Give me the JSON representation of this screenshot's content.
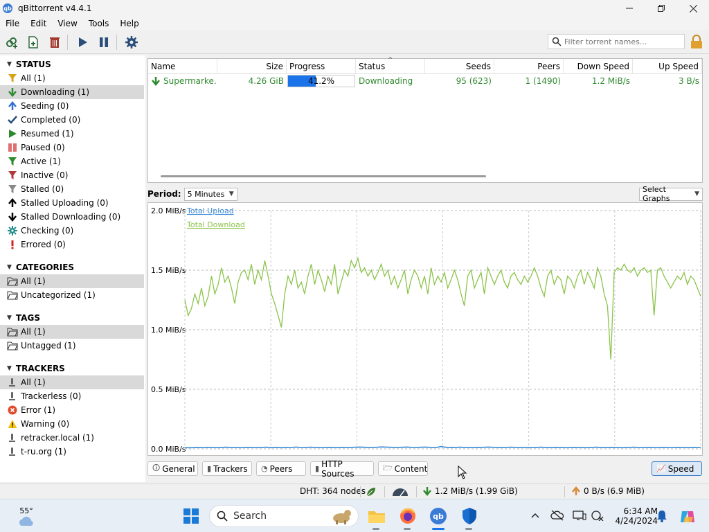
{
  "window": {
    "title": "qBittorrent v4.4.1",
    "app_icon": "qb"
  },
  "menu": [
    "File",
    "Edit",
    "View",
    "Tools",
    "Help"
  ],
  "toolbar": {
    "search_placeholder": "Filter torrent names..."
  },
  "sidebar": {
    "status": {
      "header": "STATUS",
      "items": [
        {
          "label": "All (1)",
          "icon": "filter-icon",
          "color": "#d8a21b"
        },
        {
          "label": "Downloading (1)",
          "icon": "arrow-down-icon",
          "color": "#2f8a2f"
        },
        {
          "label": "Seeding (0)",
          "icon": "arrow-up-icon",
          "color": "#2f6fd1"
        },
        {
          "label": "Completed (0)",
          "icon": "check-icon",
          "color": "#2a4d7a"
        },
        {
          "label": "Resumed (1)",
          "icon": "play-icon",
          "color": "#2f8a2f"
        },
        {
          "label": "Paused (0)",
          "icon": "pause-icon",
          "color": "#e07070"
        },
        {
          "label": "Active (1)",
          "icon": "filter-icon",
          "color": "#2f8a2f"
        },
        {
          "label": "Inactive (0)",
          "icon": "filter-icon",
          "color": "#b03a3a"
        },
        {
          "label": "Stalled (0)",
          "icon": "filter-icon",
          "color": "#888888"
        },
        {
          "label": "Stalled Uploading (0)",
          "icon": "arrow-up-icon",
          "color": "#000000"
        },
        {
          "label": "Stalled Downloading (0)",
          "icon": "arrow-down-icon",
          "color": "#000000"
        },
        {
          "label": "Checking (0)",
          "icon": "gear-icon",
          "color": "#1a8a8a"
        },
        {
          "label": "Errored (0)",
          "icon": "exclamation-icon",
          "color": "#d42020"
        }
      ]
    },
    "categories": {
      "header": "CATEGORIES",
      "items": [
        {
          "label": "All (1)",
          "icon": "folder-icon"
        },
        {
          "label": "Uncategorized (1)",
          "icon": "folder-icon"
        }
      ]
    },
    "tags": {
      "header": "TAGS",
      "items": [
        {
          "label": "All (1)",
          "icon": "folder-icon"
        },
        {
          "label": "Untagged (1)",
          "icon": "folder-icon"
        }
      ]
    },
    "trackers": {
      "header": "TRACKERS",
      "items": [
        {
          "label": "All (1)",
          "icon": "tracker-icon"
        },
        {
          "label": "Trackerless (0)",
          "icon": "tracker-icon"
        },
        {
          "label": "Error (1)",
          "icon": "error-icon"
        },
        {
          "label": "Warning (0)",
          "icon": "warning-icon"
        },
        {
          "label": "retracker.local (1)",
          "icon": "tracker-icon"
        },
        {
          "label": "t-ru.org (1)",
          "icon": "tracker-icon"
        }
      ]
    }
  },
  "torrents": {
    "columns": [
      "Name",
      "Size",
      "Progress",
      "Status",
      "Seeds",
      "Peers",
      "Down Speed",
      "Up Speed"
    ],
    "rows": [
      {
        "name": "Supermarke...",
        "size": "4.26 GiB",
        "progress_text": "41.2%",
        "progress": 0.412,
        "status": "Downloading",
        "seeds": "95 (623)",
        "peers": "1 (1490)",
        "down_speed": "1.2 MiB/s",
        "up_speed": "3 B/s"
      }
    ]
  },
  "period": {
    "label": "Period:",
    "value": "5 Minutes",
    "graphs_value": "Select Graphs"
  },
  "chart_data": {
    "type": "line",
    "title": "",
    "xlabel": "",
    "ylabel": "",
    "y_ticks": [
      "0.0 MiB/s",
      "0.5 MiB/s",
      "1.0 MiB/s",
      "1.5 MiB/s",
      "2.0 MiB/s"
    ],
    "ylim": [
      0,
      2.0
    ],
    "grid": true,
    "legend_position": "top-left",
    "series": [
      {
        "name": "Total Upload",
        "color": "#3a8ad6",
        "values": [
          0.01,
          0.01,
          0.01,
          0.012,
          0.011,
          0.01,
          0.013,
          0.012,
          0.011,
          0.01,
          0.012,
          0.014,
          0.013,
          0.012,
          0.011,
          0.01,
          0.012,
          0.013,
          0.012,
          0.011,
          0.012,
          0.013,
          0.014,
          0.012,
          0.011,
          0.012,
          0.01,
          0.011,
          0.012,
          0.013,
          0.015,
          0.012,
          0.011,
          0.013,
          0.014,
          0.012,
          0.011,
          0.01,
          0.012,
          0.013,
          0.012,
          0.011,
          0.013,
          0.012,
          0.011,
          0.012,
          0.014,
          0.015,
          0.014,
          0.013,
          0.012,
          0.013,
          0.014,
          0.016,
          0.015,
          0.014,
          0.013,
          0.012,
          0.013,
          0.014,
          0.015,
          0.013,
          0.012,
          0.013,
          0.014,
          0.015,
          0.012,
          0.011,
          0.013,
          0.02,
          0.015,
          0.012,
          0.013,
          0.012,
          0.014,
          0.013,
          0.012,
          0.011,
          0.012,
          0.013,
          0.012,
          0.014,
          0.015,
          0.013,
          0.012,
          0.011,
          0.012,
          0.013,
          0.014,
          0.012,
          0.011,
          0.012,
          0.013,
          0.012,
          0.011,
          0.013,
          0.014,
          0.012,
          0.011,
          0.012,
          0.013,
          0.012,
          0.011,
          0.01,
          0.012,
          0.013,
          0.012,
          0.011,
          0.01,
          0.012,
          0.013,
          0.014,
          0.012,
          0.011,
          0.012,
          0.013,
          0.012,
          0.011,
          0.01,
          0.012,
          0.013,
          0.014,
          0.012,
          0.011,
          0.012,
          0.013,
          0.012,
          0.011,
          0.012,
          0.013,
          0.012,
          0.011,
          0.012,
          0.013,
          0.012,
          0.011,
          0.012,
          0.013,
          0.012,
          0.011
        ]
      },
      {
        "name": "Total Download",
        "color": "#8bc34a",
        "values": [
          1.25,
          1.12,
          1.18,
          1.3,
          1.22,
          1.35,
          1.2,
          1.28,
          1.45,
          1.3,
          1.38,
          1.52,
          1.4,
          1.45,
          1.35,
          1.22,
          1.4,
          1.48,
          1.5,
          1.42,
          1.55,
          1.38,
          1.5,
          1.42,
          1.58,
          1.45,
          1.3,
          1.22,
          1.12,
          1.02,
          1.3,
          1.45,
          1.38,
          1.5,
          1.35,
          1.4,
          1.3,
          1.45,
          1.55,
          1.38,
          1.5,
          1.42,
          1.32,
          1.45,
          1.38,
          1.55,
          1.3,
          1.4,
          1.5,
          1.45,
          1.58,
          1.52,
          1.6,
          1.48,
          1.52,
          1.45,
          1.5,
          1.42,
          1.48,
          1.55,
          1.45,
          1.5,
          1.38,
          1.45,
          1.35,
          1.42,
          1.5,
          1.3,
          1.42,
          1.5,
          1.45,
          1.35,
          1.45,
          1.3,
          1.52,
          1.38,
          1.45,
          1.4,
          1.48,
          1.35,
          1.42,
          1.5,
          1.42,
          1.3,
          1.2,
          1.45,
          1.5,
          1.35,
          1.42,
          1.48,
          1.3,
          1.52,
          1.45,
          1.38,
          1.45,
          1.5,
          1.4,
          1.35,
          1.45,
          1.48,
          1.42,
          1.38,
          1.45,
          1.4,
          1.45,
          1.52,
          1.45,
          1.35,
          1.28,
          1.45,
          1.5,
          1.38,
          1.45,
          1.42,
          1.3,
          1.45,
          1.42,
          1.35,
          1.45,
          1.5,
          1.38,
          1.48,
          1.42,
          1.35,
          1.52,
          1.45,
          1.3,
          1.2,
          0.75,
          1.48,
          1.52,
          1.5,
          1.55,
          1.5,
          1.48,
          1.52,
          1.45,
          1.5,
          1.52,
          1.48,
          1.5,
          1.12,
          1.5,
          1.52,
          1.45,
          1.4,
          1.35,
          1.4,
          1.45,
          1.42,
          1.48,
          1.38,
          1.45,
          1.42,
          1.35,
          1.28
        ]
      }
    ]
  },
  "tabs": [
    {
      "label": "General",
      "icon": "info-icon"
    },
    {
      "label": "Trackers",
      "icon": "tracker-icon"
    },
    {
      "label": "Peers",
      "icon": "peers-icon"
    },
    {
      "label": "HTTP Sources",
      "icon": "server-icon"
    },
    {
      "label": "Content",
      "icon": "folder-icon"
    },
    {
      "label": "Speed",
      "icon": "chart-icon"
    }
  ],
  "statusbar": {
    "dht": "DHT: 364 nodes",
    "down": "1.2 MiB/s (1.99 GiB)",
    "up": "0 B/s (6.9 MiB)"
  },
  "taskbar": {
    "weather_temp": "55°",
    "search_text": "Search",
    "time": "6:34 AM",
    "date": "4/24/2024"
  },
  "colors": {
    "accent": "#1a73e8",
    "download_green": "#2f8a2f",
    "upload_orange": "#d98a3a"
  }
}
